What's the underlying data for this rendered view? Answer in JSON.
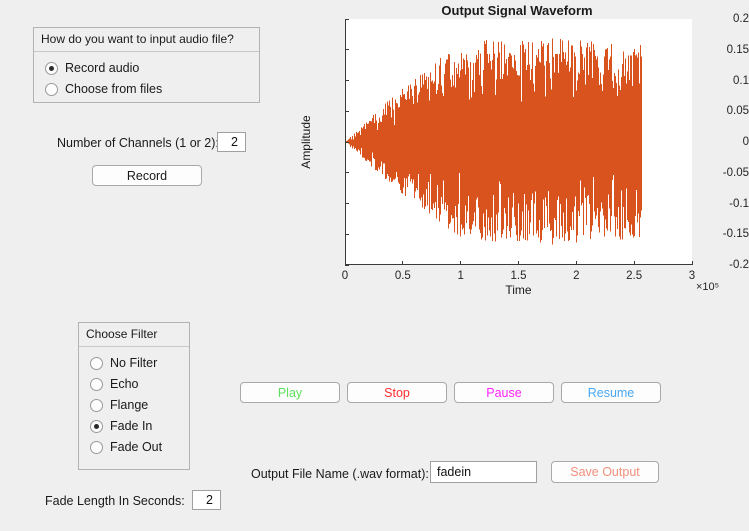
{
  "input_panel": {
    "title": "How do you want to input audio file?",
    "options": [
      {
        "label": "Record audio",
        "selected": true
      },
      {
        "label": "Choose from files",
        "selected": false
      }
    ]
  },
  "channels": {
    "label": "Number of Channels (1 or 2):",
    "value": "2"
  },
  "record_button": {
    "label": "Record"
  },
  "filter_panel": {
    "title": "Choose Filter",
    "options": [
      {
        "label": "No Filter",
        "selected": false
      },
      {
        "label": "Echo",
        "selected": false
      },
      {
        "label": "Flange",
        "selected": false
      },
      {
        "label": "Fade In",
        "selected": true
      },
      {
        "label": "Fade Out",
        "selected": false
      }
    ]
  },
  "fade_length": {
    "label": "Fade Length In Seconds:",
    "value": "2"
  },
  "transport": {
    "play": {
      "label": "Play",
      "color": "#5ee05e"
    },
    "stop": {
      "label": "Stop",
      "color": "#ff2d2d"
    },
    "pause": {
      "label": "Pause",
      "color": "#ff22ff"
    },
    "resume": {
      "label": "Resume",
      "color": "#49a8f5"
    }
  },
  "output": {
    "label": "Output File Name (.wav format):",
    "value": "fadein",
    "placeholder": "",
    "save_button": {
      "label": "Save Output",
      "color": "#f2907c"
    }
  },
  "chart_data": {
    "type": "line",
    "title": "Output Signal Waveform",
    "xlabel": "Time",
    "ylabel": "Amplitude",
    "x_exponent": "×10⁵",
    "xlim": [
      0,
      3
    ],
    "ylim": [
      -0.2,
      0.2
    ],
    "xticks": [
      0,
      0.5,
      1,
      1.5,
      2,
      2.5,
      3
    ],
    "xticklabels": [
      "0",
      "0.5",
      "1",
      "1.5",
      "2",
      "2.5",
      "3"
    ],
    "yticks": [
      -0.2,
      -0.15,
      -0.1,
      -0.05,
      0,
      0.05,
      0.1,
      0.15,
      0.2
    ],
    "yticklabels": [
      "-0.2",
      "-0.15",
      "-0.1",
      "-0.05",
      "0",
      "0.05",
      "0.1",
      "0.15",
      "0.2"
    ],
    "grid": false,
    "legend": false,
    "series": [
      {
        "name": "output signal",
        "color": "#d9531e",
        "signal_end_x": 2.56,
        "envelope_x": [
          0.0,
          0.2,
          0.4,
          0.6,
          0.8,
          1.0,
          1.2,
          1.4,
          1.6,
          1.8,
          2.0,
          2.2,
          2.4,
          2.56
        ],
        "envelope_upper": [
          0.0,
          0.037,
          0.072,
          0.104,
          0.135,
          0.158,
          0.168,
          0.163,
          0.166,
          0.171,
          0.167,
          0.162,
          0.165,
          0.163
        ],
        "envelope_lower": [
          0.0,
          -0.036,
          -0.07,
          -0.101,
          -0.132,
          -0.155,
          -0.166,
          -0.16,
          -0.163,
          -0.168,
          -0.164,
          -0.159,
          -0.162,
          -0.16
        ]
      }
    ]
  }
}
